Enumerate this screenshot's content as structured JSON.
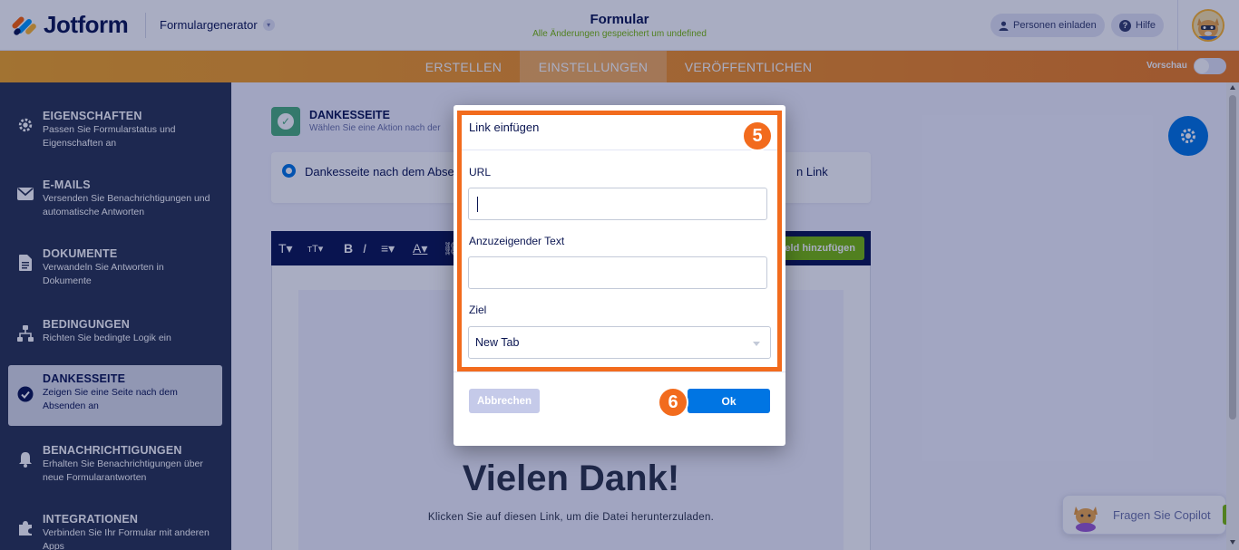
{
  "app": {
    "brand": "Jotform",
    "builder_label": "Formulargenerator",
    "form_title": "Formular",
    "save_status": "Alle Änderungen gespeichert um undefined",
    "invite_label": "Personen einladen",
    "help_label": "Hilfe"
  },
  "tabs": [
    {
      "label": "ERSTELLEN",
      "active": false
    },
    {
      "label": "EINSTELLUNGEN",
      "active": true
    },
    {
      "label": "VERÖFFENTLICHEN",
      "active": false
    }
  ],
  "preview": {
    "label": "Vorschau",
    "enabled": false
  },
  "sidebar": {
    "items": [
      {
        "title": "EIGENSCHAFTEN",
        "desc": "Passen Sie Formularstatus und Eigenschaften an",
        "icon": "gear-icon"
      },
      {
        "title": "E-MAILS",
        "desc": "Versenden Sie Benachrichtigungen und automatische Antworten",
        "icon": "mail-icon"
      },
      {
        "title": "DOKUMENTE",
        "desc": "Verwandeln Sie Antworten in Dokumente",
        "icon": "document-icon"
      },
      {
        "title": "BEDINGUNGEN",
        "desc": "Richten Sie bedingte Logik ein",
        "icon": "sitemap-icon"
      },
      {
        "title": "DANKESSEITE",
        "desc": "Zeigen Sie eine Seite nach dem Absenden an",
        "icon": "check-circle-icon",
        "active": true
      },
      {
        "title": "BENACHRICHTIGUNGEN",
        "desc": "Erhalten Sie Benachrichtigungen über neue Formularantworten",
        "icon": "bell-icon"
      },
      {
        "title": "INTEGRATIONEN",
        "desc": "Verbinden Sie Ihr Formular mit anderen Apps",
        "icon": "puzzle-icon"
      }
    ]
  },
  "thankyou": {
    "section_title": "DANKESSEITE",
    "section_sub": "Wählen Sie eine Aktion nach der",
    "option_label": "Dankesseite nach dem Abser",
    "option_right": "n Link",
    "add_field_label": "eld hinzufügen",
    "heading": "Vielen Dank!",
    "body_text": "Klicken Sie auf diesen Link, um die Datei herunterzuladen."
  },
  "modal": {
    "title": "Link einfügen",
    "url_label": "URL",
    "url_value": "",
    "display_text_label": "Anzuzeigender Text",
    "display_text_value": "",
    "target_label": "Ziel",
    "target_value": "New Tab",
    "cancel_label": "Abbrechen",
    "ok_label": "Ok"
  },
  "steps": {
    "step5": "5",
    "step6": "6"
  },
  "copilot": {
    "label": "Fragen Sie Copilot"
  },
  "colors": {
    "accent_orange": "#f26b1d",
    "primary_blue": "#0075e3",
    "navy": "#0a1551",
    "sidebar_bg": "#293450",
    "green": "#78bb07"
  }
}
